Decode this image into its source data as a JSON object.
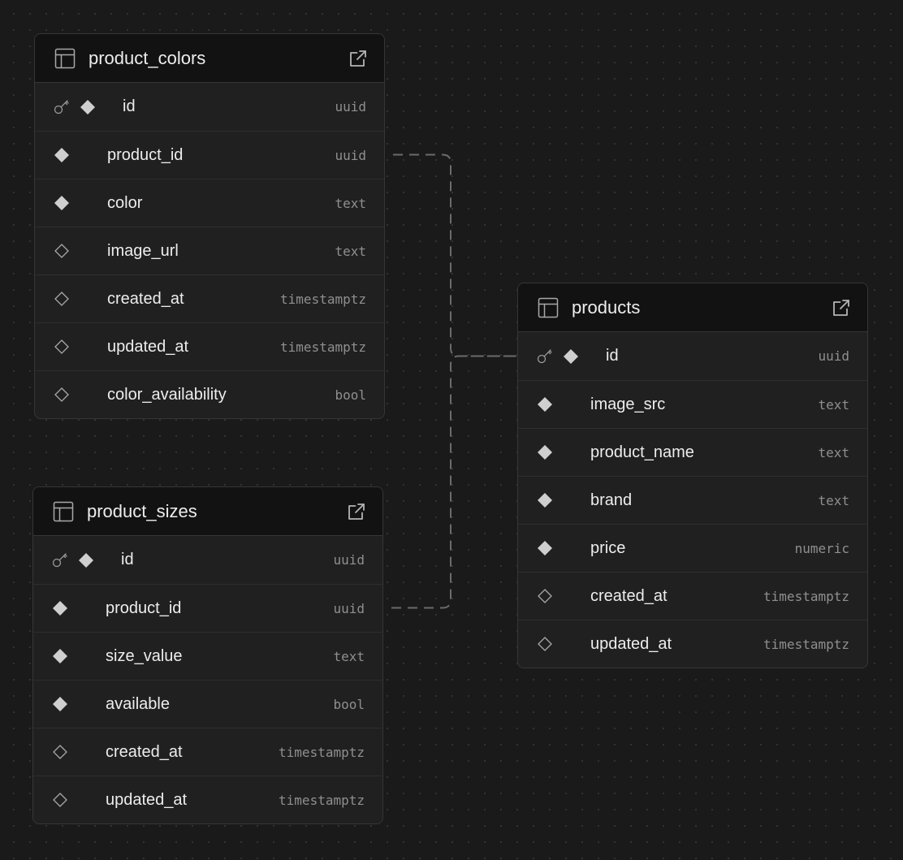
{
  "tables": [
    {
      "id": "product_colors",
      "name": "product_colors",
      "columns": [
        {
          "name": "id",
          "type": "uuid",
          "pk": true,
          "required": true
        },
        {
          "name": "product_id",
          "type": "uuid",
          "pk": false,
          "required": true
        },
        {
          "name": "color",
          "type": "text",
          "pk": false,
          "required": true
        },
        {
          "name": "image_url",
          "type": "text",
          "pk": false,
          "required": false
        },
        {
          "name": "created_at",
          "type": "timestamptz",
          "pk": false,
          "required": false
        },
        {
          "name": "updated_at",
          "type": "timestamptz",
          "pk": false,
          "required": false
        },
        {
          "name": "color_availability",
          "type": "bool",
          "pk": false,
          "required": false
        }
      ]
    },
    {
      "id": "product_sizes",
      "name": "product_sizes",
      "columns": [
        {
          "name": "id",
          "type": "uuid",
          "pk": true,
          "required": true
        },
        {
          "name": "product_id",
          "type": "uuid",
          "pk": false,
          "required": true
        },
        {
          "name": "size_value",
          "type": "text",
          "pk": false,
          "required": true
        },
        {
          "name": "available",
          "type": "bool",
          "pk": false,
          "required": true
        },
        {
          "name": "created_at",
          "type": "timestamptz",
          "pk": false,
          "required": false
        },
        {
          "name": "updated_at",
          "type": "timestamptz",
          "pk": false,
          "required": false
        }
      ]
    },
    {
      "id": "products",
      "name": "products",
      "columns": [
        {
          "name": "id",
          "type": "uuid",
          "pk": true,
          "required": true
        },
        {
          "name": "image_src",
          "type": "text",
          "pk": false,
          "required": true
        },
        {
          "name": "product_name",
          "type": "text",
          "pk": false,
          "required": true
        },
        {
          "name": "brand",
          "type": "text",
          "pk": false,
          "required": true
        },
        {
          "name": "price",
          "type": "numeric",
          "pk": false,
          "required": true
        },
        {
          "name": "created_at",
          "type": "timestamptz",
          "pk": false,
          "required": false
        },
        {
          "name": "updated_at",
          "type": "timestamptz",
          "pk": false,
          "required": false
        }
      ]
    }
  ],
  "relations": [
    {
      "from_table": "product_colors",
      "from_column": "product_id",
      "to_table": "products",
      "to_column": "id"
    },
    {
      "from_table": "product_sizes",
      "from_column": "product_id",
      "to_table": "products",
      "to_column": "id"
    }
  ],
  "colors": {
    "canvas": "#1a1a1a",
    "grid_dot": "#333333",
    "table_bg": "#202020",
    "header_bg": "#121212",
    "border": "#363636",
    "text": "#ededed",
    "type_text": "#8f8f8f",
    "connector": "#6b6b6b"
  },
  "icons": {
    "table": "table-grid-icon",
    "open": "external-link-icon",
    "primary_key": "key-icon",
    "required": "filled-diamond-icon",
    "nullable": "outline-diamond-icon"
  }
}
